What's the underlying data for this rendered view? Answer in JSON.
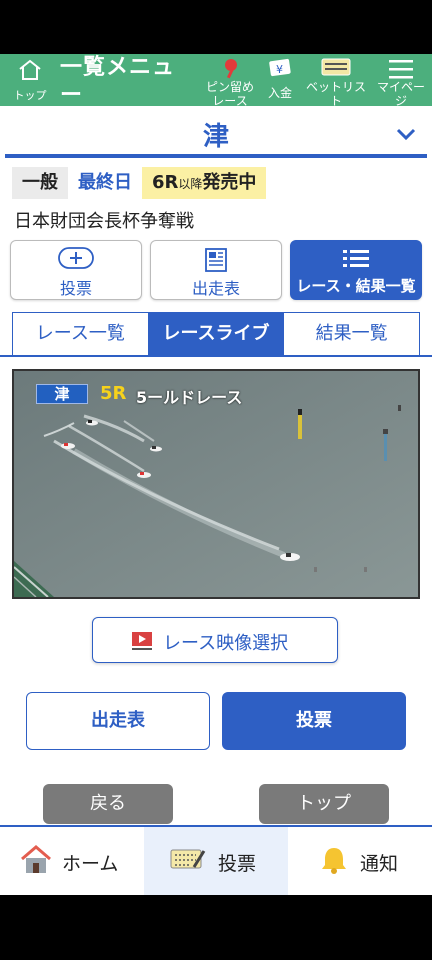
{
  "topnav": {
    "home_label": "トップ",
    "menu_title": "一覧メニュー",
    "pin_label": "ピン留めレース",
    "deposit_label": "入金",
    "betlist_label": "ベットリスト",
    "mypage_label": "マイページ"
  },
  "venue": {
    "name": "津"
  },
  "badges": {
    "category": "一般",
    "day": "最終日",
    "sale_race": "6R",
    "sale_suffix": "以降",
    "sale_status": "発売中"
  },
  "race_title": "日本財団会長杯争奪戦",
  "cards": [
    {
      "label": "投票"
    },
    {
      "label": "出走表"
    },
    {
      "label": "レース・結果一覧"
    }
  ],
  "subtabs": [
    {
      "label": "レース一覧"
    },
    {
      "label": "レースライブ"
    },
    {
      "label": "結果一覧"
    }
  ],
  "video": {
    "venue": "津",
    "race": "5R",
    "race_type": "5ールドレース"
  },
  "video_select_label": "レース映像選択",
  "actions": {
    "entries_label": "出走表",
    "vote_label": "投票",
    "back_label": "戻る",
    "top_label": "トップ"
  },
  "tabbar": [
    {
      "label": "ホーム"
    },
    {
      "label": "投票"
    },
    {
      "label": "通知"
    }
  ]
}
